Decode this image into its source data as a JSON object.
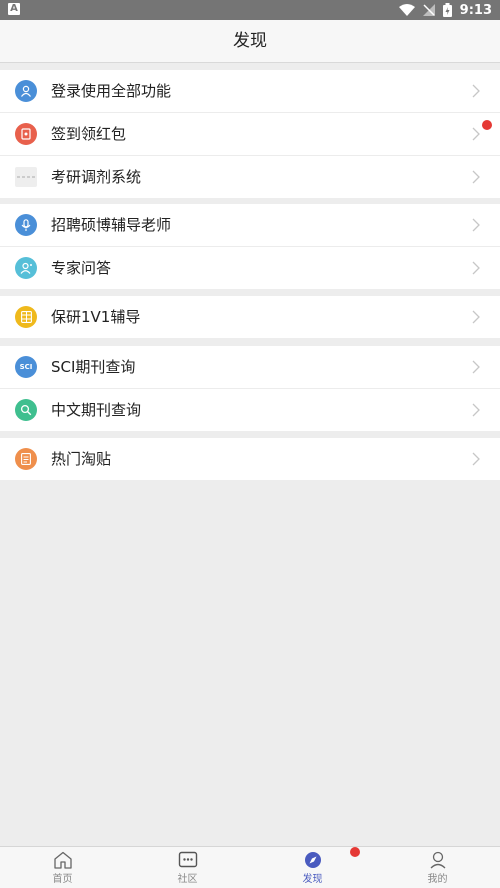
{
  "status_bar": {
    "time": "9:13",
    "notification": "A"
  },
  "header": {
    "title": "发现"
  },
  "groups": [
    {
      "items": [
        {
          "label": "登录使用全部功能",
          "icon": "user-icon",
          "color": "#4a8fd8"
        },
        {
          "label": "签到领红包",
          "icon": "red-packet-icon",
          "color": "#e8604c",
          "badge": true
        },
        {
          "label": "考研调剂系统",
          "icon": "thumbnail-image",
          "color": "#eeeeee"
        }
      ]
    },
    {
      "items": [
        {
          "label": "招聘硕博辅导老师",
          "icon": "microphone-icon",
          "color": "#4a8fd8"
        },
        {
          "label": "专家问答",
          "icon": "expert-icon",
          "color": "#56bfd8"
        }
      ]
    },
    {
      "items": [
        {
          "label": "保研1V1辅导",
          "icon": "grid-icon",
          "color": "#efb91c"
        }
      ]
    },
    {
      "items": [
        {
          "label": "SCI期刊查询",
          "icon": "sci-icon",
          "color": "#4a8fd8",
          "icon_text": "SCI"
        },
        {
          "label": "中文期刊查询",
          "icon": "search-icon",
          "color": "#3fbf8f"
        }
      ]
    },
    {
      "items": [
        {
          "label": "热门淘贴",
          "icon": "document-icon",
          "color": "#ef8f4c"
        }
      ]
    }
  ],
  "tabbar": {
    "tabs": [
      {
        "label": "首页",
        "icon": "home-icon"
      },
      {
        "label": "社区",
        "icon": "chat-icon"
      },
      {
        "label": "发现",
        "icon": "compass-icon",
        "active": true
      },
      {
        "label": "我的",
        "icon": "profile-icon"
      }
    ]
  },
  "colors": {
    "accent": "#4a5bbf",
    "badge": "#e53935"
  }
}
